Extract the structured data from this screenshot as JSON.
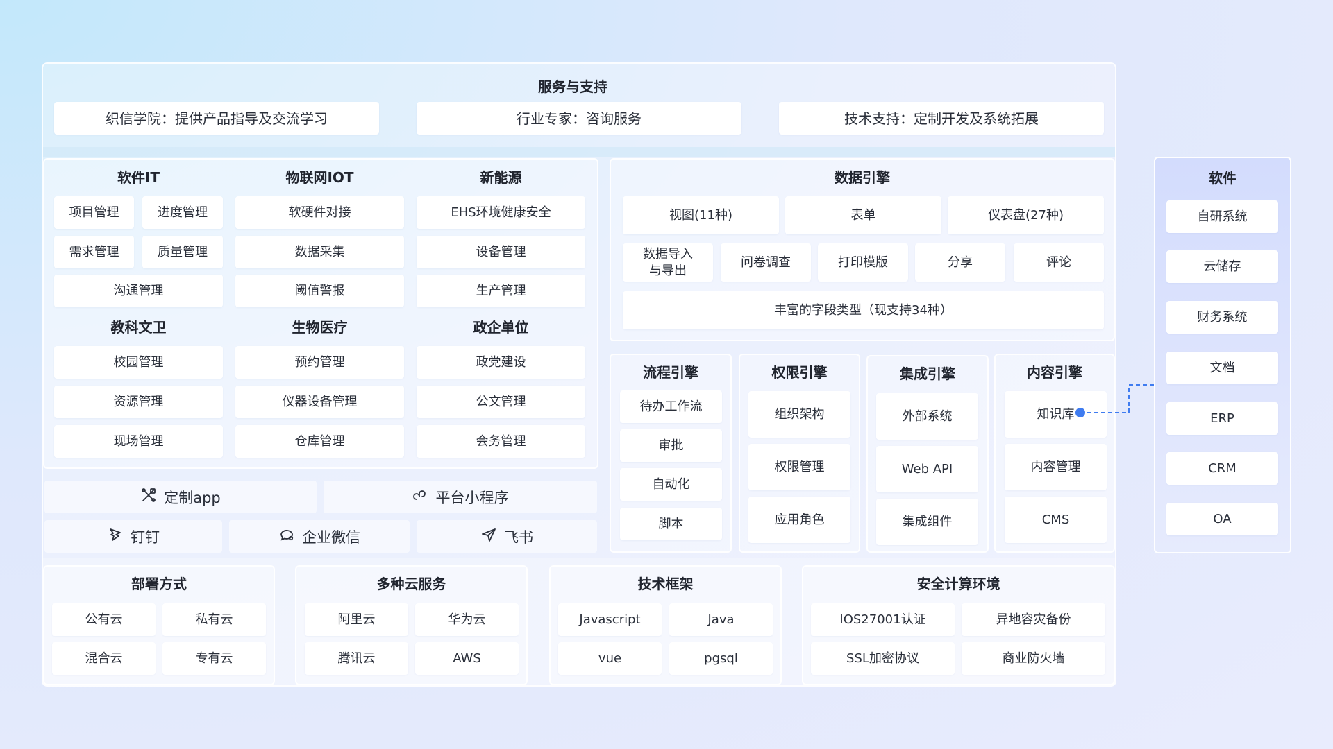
{
  "colors": {
    "accent": "#3f7cf0",
    "card": "#ffffff"
  },
  "service": {
    "title": "服务与支持",
    "items": [
      "织信学院：提供产品指导及交流学习",
      "行业专家：咨询服务",
      "技术支持：定制开发及系统拓展"
    ]
  },
  "industries": [
    {
      "title": "软件IT",
      "items": [
        "项目管理",
        "进度管理",
        "需求管理",
        "质量管理",
        "沟通管理"
      ]
    },
    {
      "title": "物联网IOT",
      "items": [
        "软硬件对接",
        "数据采集",
        "阈值警报"
      ]
    },
    {
      "title": "新能源",
      "items": [
        "EHS环境健康安全",
        "设备管理",
        "生产管理"
      ]
    },
    {
      "title": "教科文卫",
      "items": [
        "校园管理",
        "资源管理",
        "现场管理"
      ]
    },
    {
      "title": "生物医疗",
      "items": [
        "预约管理",
        "仪器设备管理",
        "仓库管理"
      ]
    },
    {
      "title": "政企单位",
      "items": [
        "政党建设",
        "公文管理",
        "会务管理"
      ]
    }
  ],
  "channels": [
    {
      "label": "定制app",
      "icon": "tools-icon"
    },
    {
      "label": "平台小程序",
      "icon": "mini-program-icon"
    },
    {
      "label": "钉钉",
      "icon": "dingtalk-icon"
    },
    {
      "label": "企业微信",
      "icon": "wecom-icon"
    },
    {
      "label": "飞书",
      "icon": "feishu-icon"
    }
  ],
  "data_engine": {
    "title": "数据引擎",
    "row1": [
      "视图(11种)",
      "表单",
      "仪表盘(27种)"
    ],
    "row2": [
      "数据导入\n与导出",
      "问卷调查",
      "打印模版",
      "分享",
      "评论"
    ],
    "row3": "丰富的字段类型（现支持34种）"
  },
  "engines": [
    {
      "title": "流程引擎",
      "items": [
        "待办工作流",
        "审批",
        "自动化",
        "脚本"
      ]
    },
    {
      "title": "权限引擎",
      "items": [
        "组织架构",
        "权限管理",
        "应用角色"
      ]
    },
    {
      "title": "集成引擎",
      "items": [
        "外部系统",
        "Web API",
        "集成组件"
      ]
    },
    {
      "title": "内容引擎",
      "items": [
        "知识库",
        "内容管理",
        "CMS"
      ]
    }
  ],
  "software": {
    "title": "软件",
    "items": [
      "自研系统",
      "云储存",
      "财务系统",
      "文档",
      "ERP",
      "CRM",
      "OA"
    ]
  },
  "bottom": [
    {
      "title": "部署方式",
      "items": [
        "公有云",
        "私有云",
        "混合云",
        "专有云"
      ]
    },
    {
      "title": "多种云服务",
      "items": [
        "阿里云",
        "华为云",
        "腾讯云",
        "AWS"
      ]
    },
    {
      "title": "技术框架",
      "items": [
        "Javascript",
        "Java",
        "vue",
        "pgsql"
      ]
    },
    {
      "title": "安全计算环境",
      "items": [
        "IOS27001认证",
        "异地容灾备份",
        "SSL加密协议",
        "商业防火墙"
      ]
    }
  ]
}
